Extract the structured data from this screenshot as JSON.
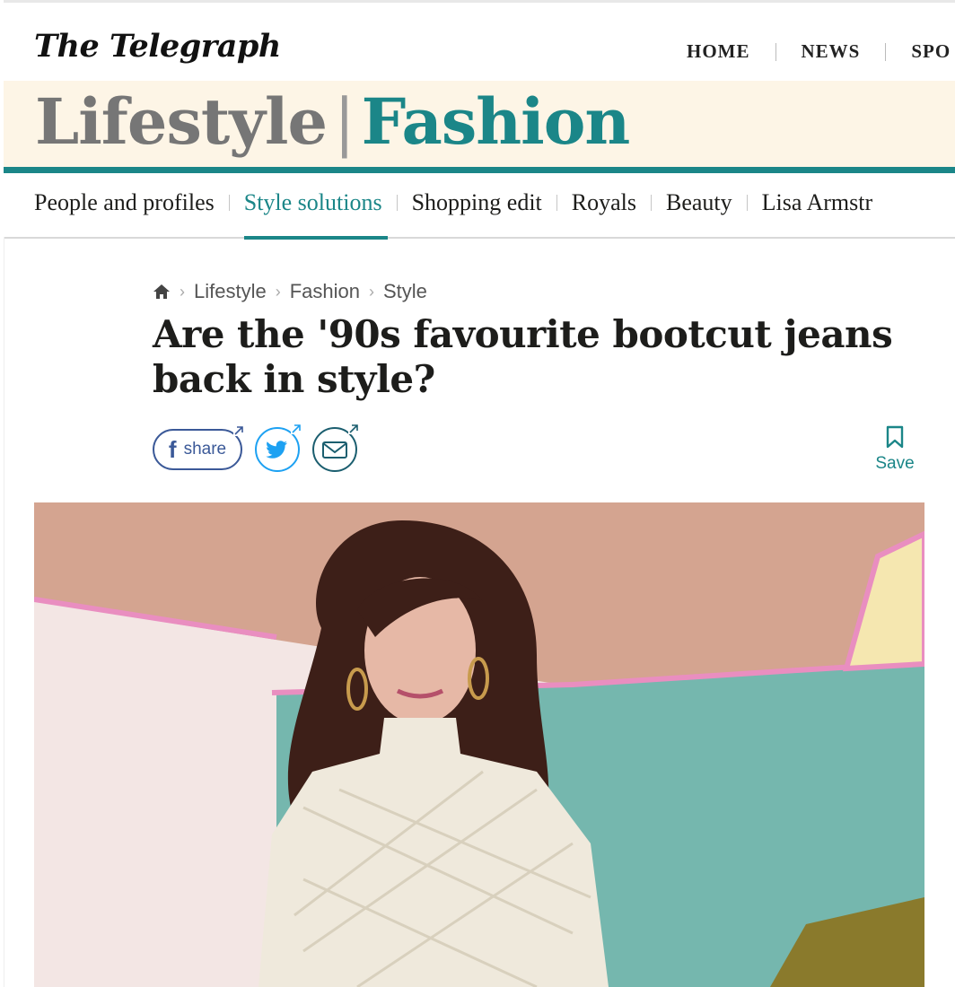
{
  "masthead": {
    "logo": "The Telegraph",
    "nav": [
      "HOME",
      "NEWS",
      "SPO"
    ]
  },
  "section": {
    "parent": "Lifestyle",
    "separator": "|",
    "name": "Fashion"
  },
  "subnav": {
    "items": [
      {
        "label": "People and profiles",
        "active": false
      },
      {
        "label": "Style solutions",
        "active": true
      },
      {
        "label": "Shopping edit",
        "active": false
      },
      {
        "label": "Royals",
        "active": false
      },
      {
        "label": "Beauty",
        "active": false
      },
      {
        "label": "Lisa Armstr",
        "active": false
      }
    ]
  },
  "breadcrumb": {
    "icon": "home-icon",
    "items": [
      "Lifestyle",
      "Fashion",
      "Style"
    ]
  },
  "article": {
    "headline": "Are the '90s favourite bootcut jeans back in style?"
  },
  "share": {
    "facebook_label": "share",
    "twitter_icon": "twitter-icon",
    "email_icon": "email-icon",
    "save_label": "Save"
  },
  "colors": {
    "accent": "#1b8688",
    "band": "#fdf5e6",
    "facebook": "#3b5998",
    "twitter": "#1da1f2"
  }
}
